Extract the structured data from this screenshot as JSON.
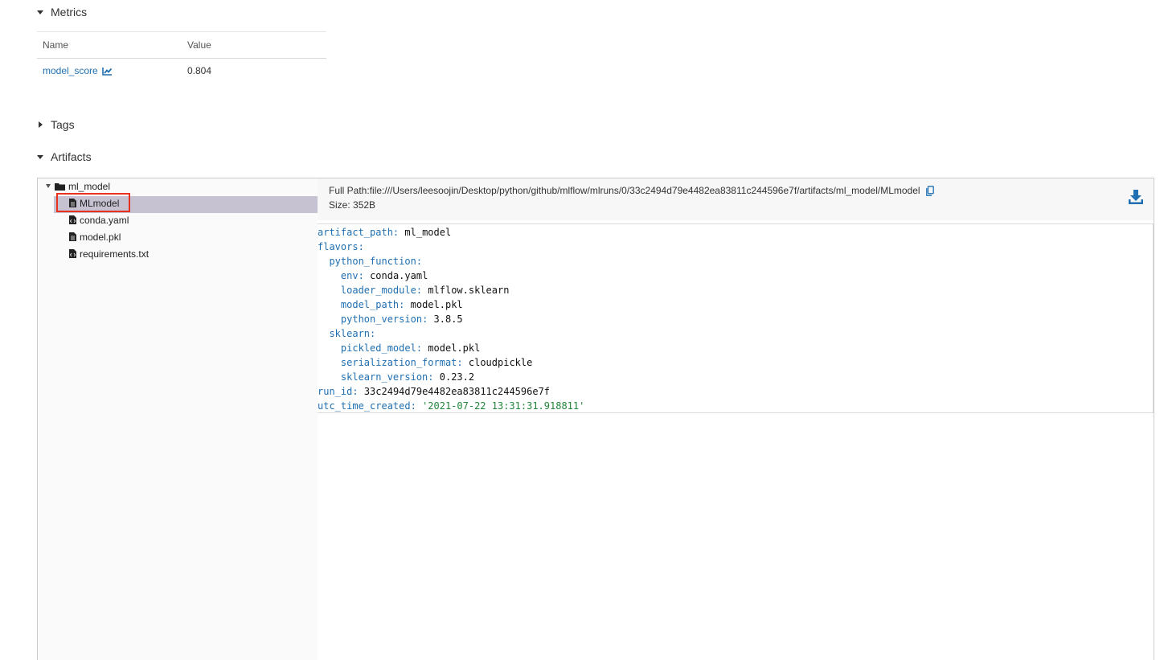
{
  "sections": {
    "metrics_label": "Metrics",
    "tags_label": "Tags",
    "artifacts_label": "Artifacts"
  },
  "metrics_table": {
    "headers": [
      "Name",
      "Value"
    ],
    "rows": [
      {
        "name": "model_score",
        "value": "0.804"
      }
    ]
  },
  "artifact_tree": {
    "folder": "ml_model",
    "files": [
      "MLmodel",
      "conda.yaml",
      "model.pkl",
      "requirements.txt"
    ],
    "selected": "MLmodel"
  },
  "file_info": {
    "full_path_label": "Full Path:",
    "full_path": "file:///Users/leesoojin/Desktop/python/github/mlflow/mlruns/0/33c2494d79e4482ea83811c244596e7f/artifacts/ml_model/MLmodel",
    "size_label": "Size: ",
    "size": "352B"
  },
  "yaml_lines": [
    {
      "indent": "",
      "key": "artifact_path",
      "value": "ml_model",
      "vtype": "v"
    },
    {
      "indent": "",
      "key": "flavors",
      "value": "",
      "vtype": "v"
    },
    {
      "indent": "  ",
      "key": "python_function",
      "value": "",
      "vtype": "v"
    },
    {
      "indent": "    ",
      "key": "env",
      "value": "conda.yaml",
      "vtype": "v"
    },
    {
      "indent": "    ",
      "key": "loader_module",
      "value": "mlflow.sklearn",
      "vtype": "v"
    },
    {
      "indent": "    ",
      "key": "model_path",
      "value": "model.pkl",
      "vtype": "v"
    },
    {
      "indent": "    ",
      "key": "python_version",
      "value": "3.8.5",
      "vtype": "v"
    },
    {
      "indent": "  ",
      "key": "sklearn",
      "value": "",
      "vtype": "v"
    },
    {
      "indent": "    ",
      "key": "pickled_model",
      "value": "model.pkl",
      "vtype": "v"
    },
    {
      "indent": "    ",
      "key": "serialization_format",
      "value": "cloudpickle",
      "vtype": "v"
    },
    {
      "indent": "    ",
      "key": "sklearn_version",
      "value": "0.23.2",
      "vtype": "v"
    },
    {
      "indent": "",
      "key": "run_id",
      "value": "33c2494d79e4482ea83811c244596e7f",
      "vtype": "v"
    },
    {
      "indent": "",
      "key": "utc_time_created",
      "value": "'2021-07-22 13:31:31.918811'",
      "vtype": "s"
    }
  ],
  "colors": {
    "link": "#1f6fb2",
    "selected_row": "#c7c2d1",
    "highlight_border": "#e8321f",
    "yaml_key": "#1f6fb2",
    "yaml_string": "#22863a"
  },
  "icons": {
    "chart": "chart-line-icon",
    "folder": "folder-icon",
    "file": "file-icon",
    "code_file": "code-file-icon",
    "copy": "copy-icon",
    "download": "download-icon"
  }
}
